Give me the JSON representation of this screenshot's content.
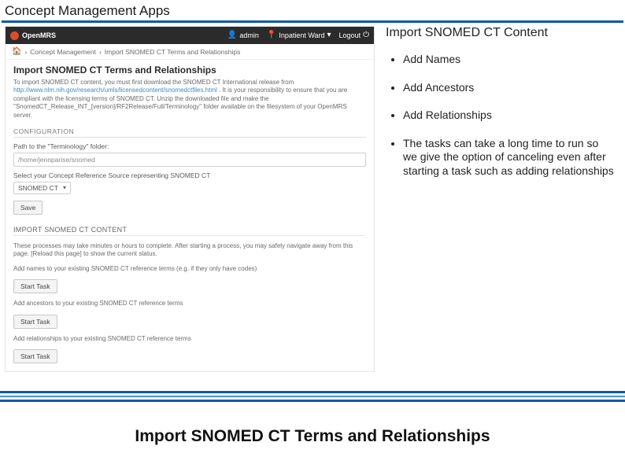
{
  "slide": {
    "title": "Concept Management Apps",
    "caption": "Import SNOMED CT Terms and Relationships"
  },
  "right": {
    "title": "Import SNOMED CT Content",
    "bullets": [
      "Add Names",
      "Add Ancestors",
      "Add Relationships",
      "The tasks can take a long time to run so we give the option of canceling even after starting a task such as adding relationships"
    ]
  },
  "omrs": {
    "brand": "OpenMRS",
    "nav": {
      "admin": "admin",
      "ward": "Inpatient Ward",
      "logout": "Logout"
    },
    "breadcrumb": {
      "b1": "Concept Management",
      "b2": "Import SNOMED CT Terms and Relationships"
    },
    "page_title": "Import SNOMED CT Terms and Relationships",
    "intro_prefix": "To import SNOMED CT content, you must first download the SNOMED CT International release from ",
    "intro_link": "http://www.nlm.nih.gov/research/umls/licensedcontent/snomedctfiles.html",
    "intro_suffix": ". It is your responsibility to ensure that you are compliant with the licensing terms of SNOMED CT. Unzip the downloaded file and make the \"SnomedCT_Release_INT_[version]/RF2Release/Full/Terminology\" folder available on the filesystem of your OpenMRS server.",
    "config_label": "CONFIGURATION",
    "path_label": "Path to the \"Terminology\" folder:",
    "path_value": "/home/jennparise/snomed",
    "source_label": "Select your Concept Reference Source representing SNOMED CT",
    "source_value": "SNOMED CT",
    "save_label": "Save",
    "import_section": "IMPORT SNOMED CT CONTENT",
    "import_note": "These processes may take minutes or hours to complete. After starting a process, you may safely navigate away from this page. [Reload this page] to show the current status.",
    "task1": "Add names to your existing SNOMED CT reference terms (e.g. if they only have codes)",
    "task2": "Add ancestors to your existing SNOMED CT reference terms",
    "task3": "Add relationships to your existing SNOMED CT reference terms",
    "start_label": "Start Task"
  }
}
